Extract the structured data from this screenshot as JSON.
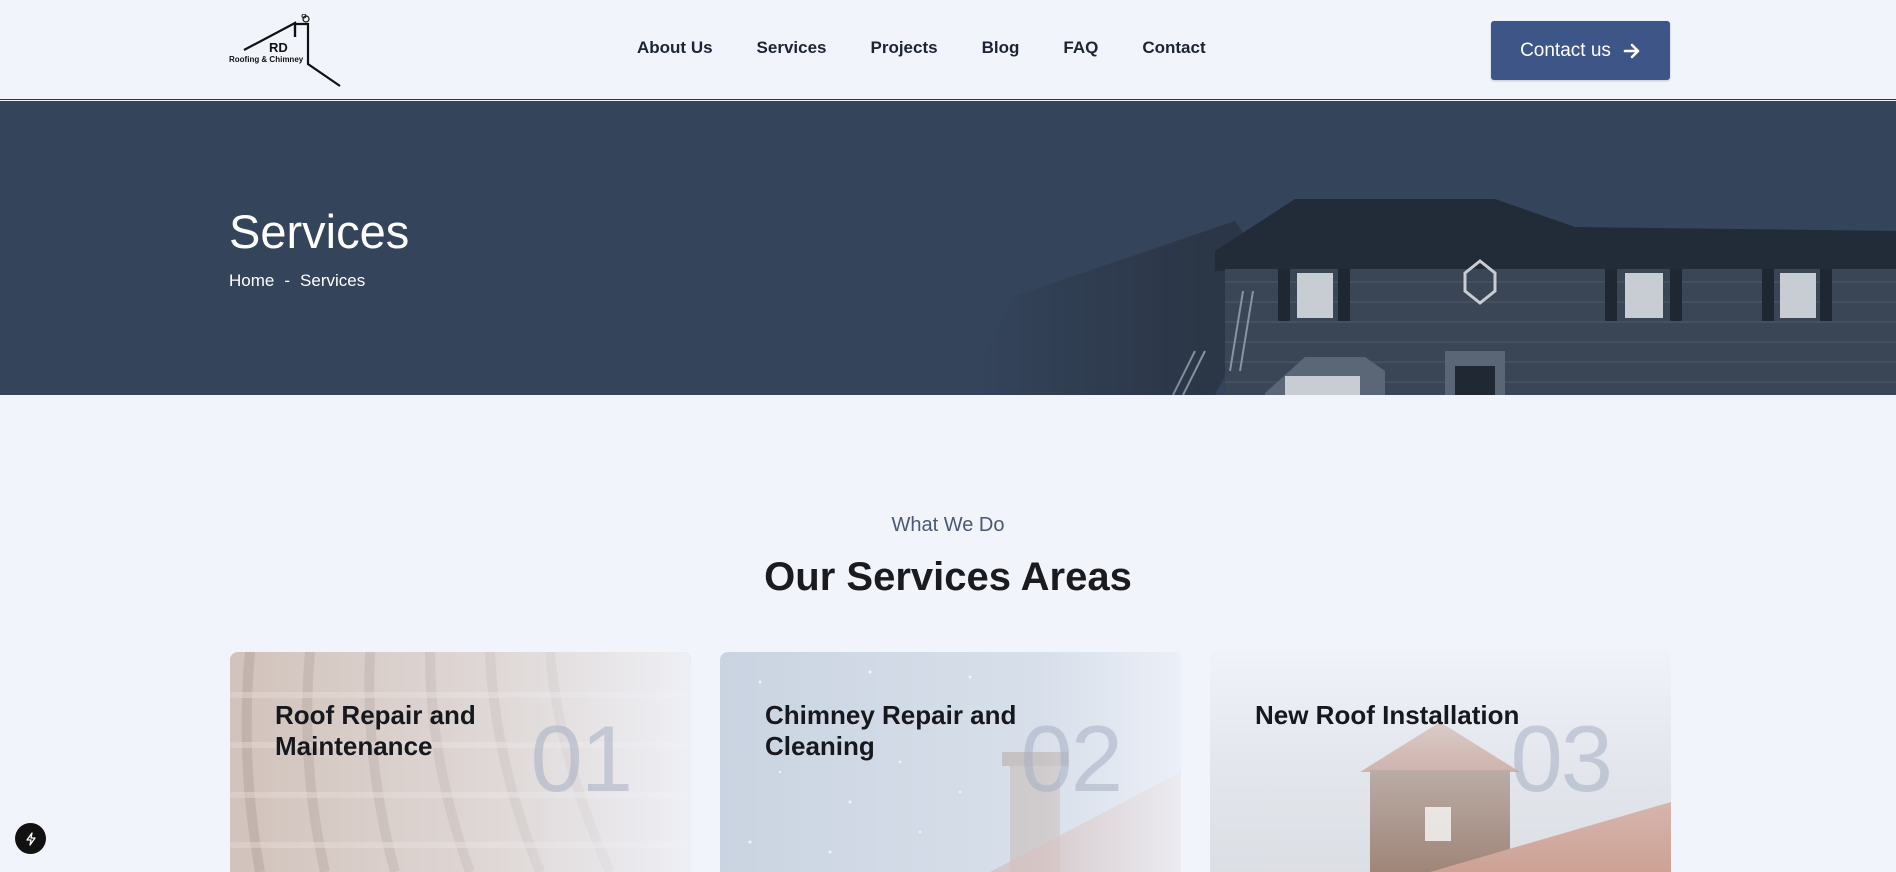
{
  "header": {
    "logo": {
      "initials": "RD",
      "tagline": "Roofing & Chimney"
    },
    "nav": [
      {
        "label": "About Us"
      },
      {
        "label": "Services"
      },
      {
        "label": "Projects"
      },
      {
        "label": "Blog"
      },
      {
        "label": "FAQ"
      },
      {
        "label": "Contact"
      }
    ],
    "cta_label": "Contact us",
    "cta_icon": "arrow-right-icon"
  },
  "hero": {
    "title": "Services",
    "breadcrumb": {
      "home": "Home",
      "separator": "-",
      "current": "Services"
    }
  },
  "services": {
    "eyebrow": "What We Do",
    "title": "Our Services Areas",
    "cards": [
      {
        "title": "Roof Repair and Maintenance",
        "number": "01"
      },
      {
        "title": "Chimney Repair and Cleaning",
        "number": "02"
      },
      {
        "title": "New Roof Installation",
        "number": "03"
      }
    ]
  },
  "colors": {
    "accent": "#3e5587",
    "hero_bg": "#34445b",
    "page_bg": "#f1f4fb"
  }
}
